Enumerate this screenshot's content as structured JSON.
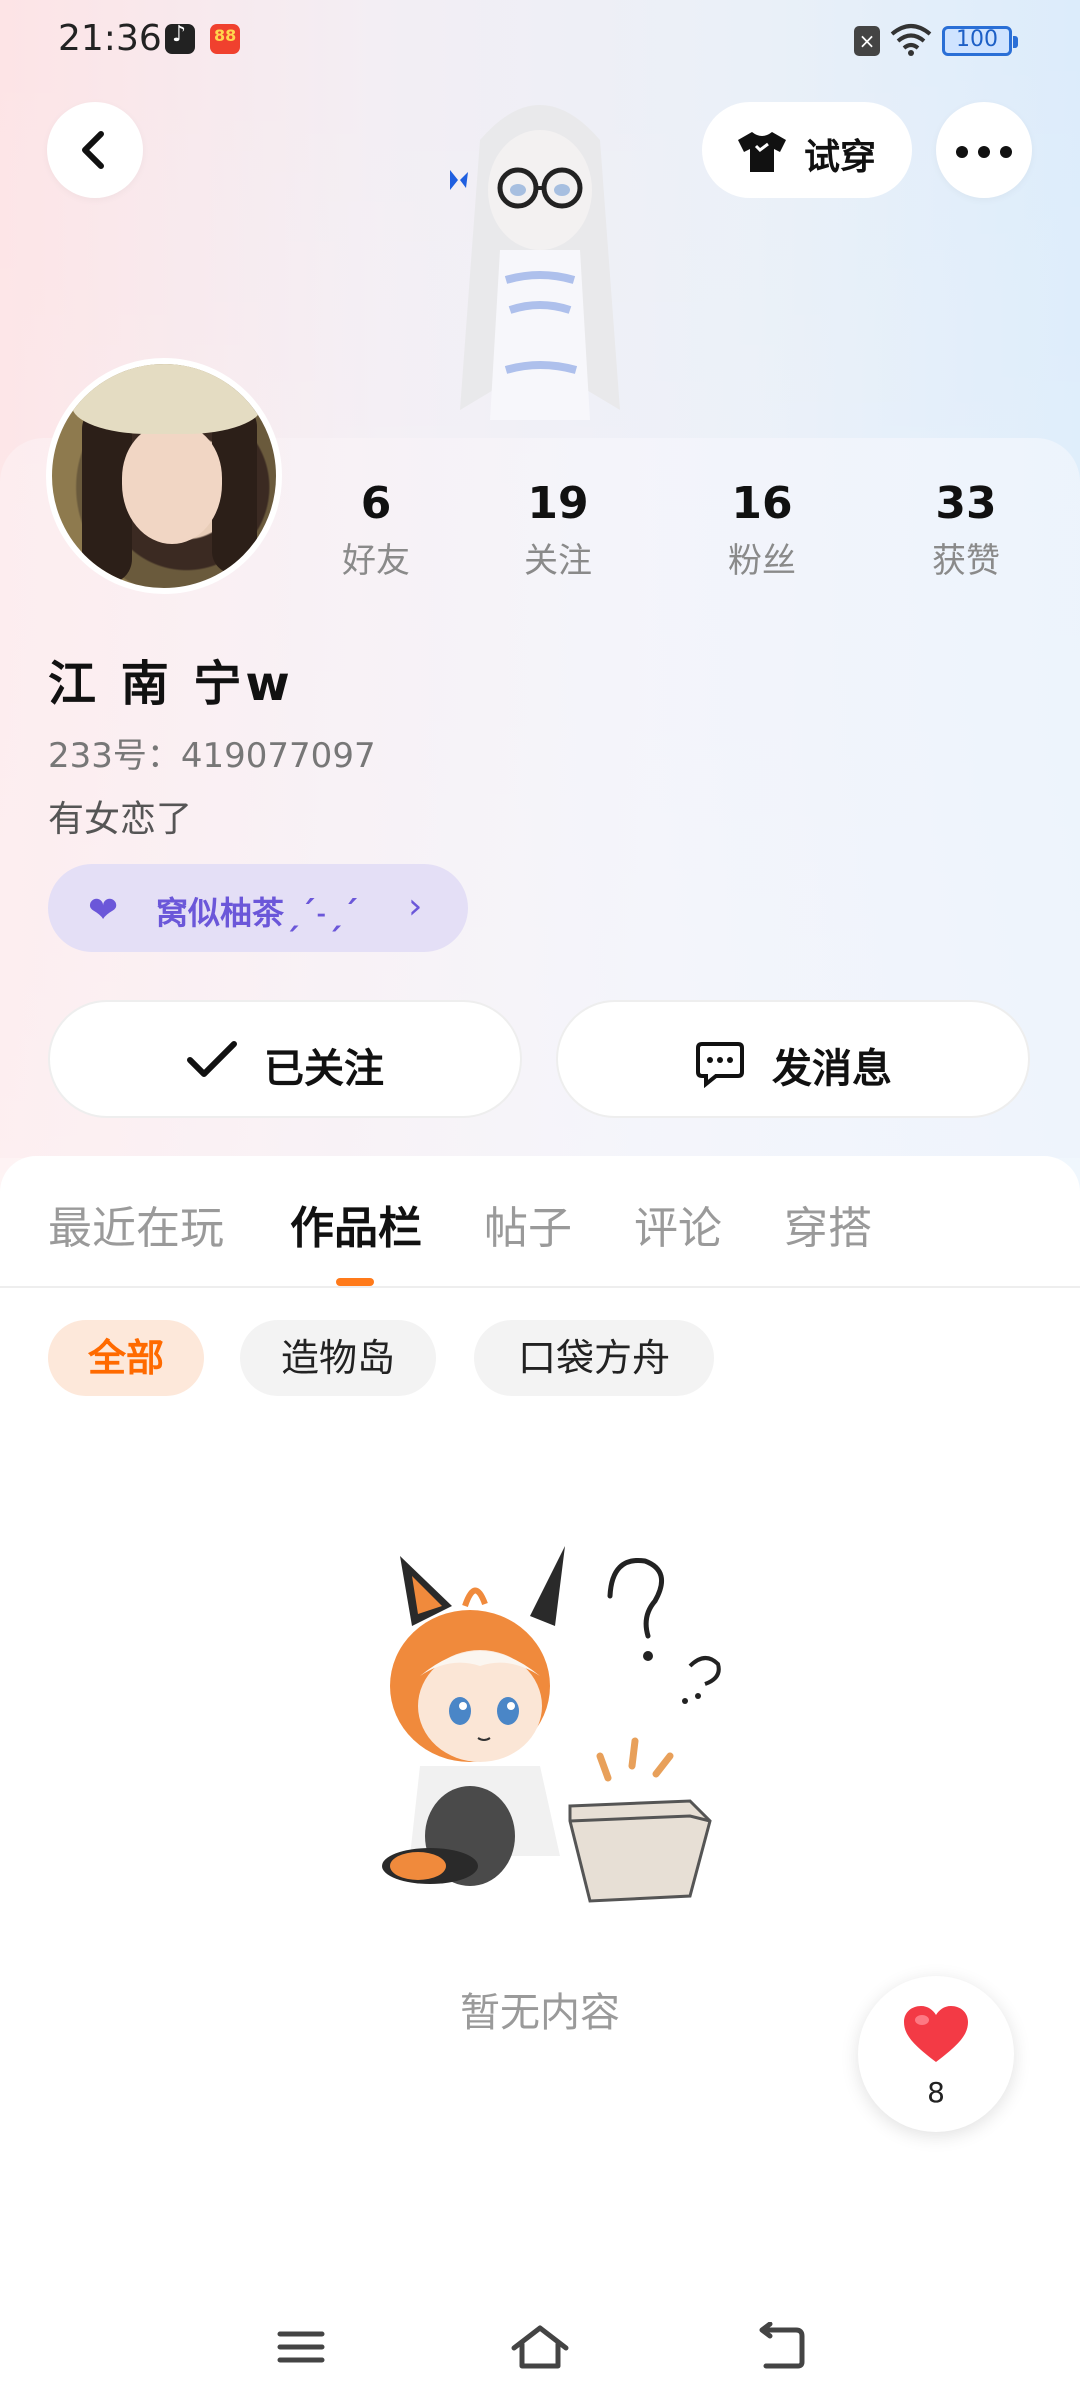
{
  "status_bar": {
    "time": "21:36",
    "battery": "100"
  },
  "header": {
    "tryon_label": "试穿"
  },
  "stats": [
    {
      "value": "6",
      "label": "好友"
    },
    {
      "value": "19",
      "label": "关注"
    },
    {
      "value": "16",
      "label": "粉丝"
    },
    {
      "value": "33",
      "label": "获赞"
    }
  ],
  "profile": {
    "username": "江 南 宁w",
    "uid": "233号：419077097",
    "bio": "有女恋了",
    "couple_tag": "窝似柚茶ˏˊ˗ˏˊ"
  },
  "actions": {
    "follow_label": "已关注",
    "message_label": "发消息"
  },
  "tabs": [
    {
      "label": "最近在玩",
      "active": false
    },
    {
      "label": "作品栏",
      "active": true
    },
    {
      "label": "帖子",
      "active": false
    },
    {
      "label": "评论",
      "active": false
    },
    {
      "label": "穿搭",
      "active": false
    }
  ],
  "filters": [
    {
      "label": "全部",
      "active": true
    },
    {
      "label": "造物岛",
      "active": false
    },
    {
      "label": "口袋方舟",
      "active": false
    }
  ],
  "empty_state": {
    "text": "暂无内容"
  },
  "like_button": {
    "count": "8"
  },
  "colors": {
    "accent": "#ff7a1a",
    "couple_purple": "#6b57d9",
    "heart_red": "#f33a45"
  }
}
